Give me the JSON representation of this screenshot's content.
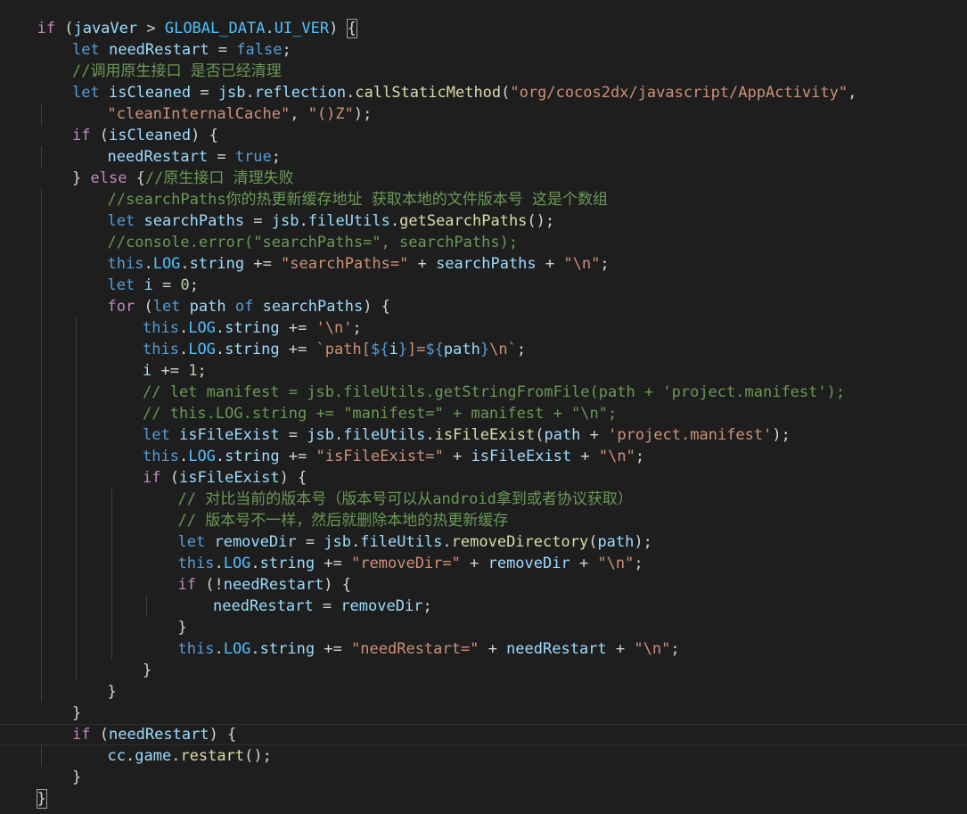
{
  "editor": {
    "title": "code-editor",
    "colors": {
      "background": "#1e1e1e",
      "keyword": "#569cd6",
      "control": "#c586c0",
      "variable": "#9cdcfe",
      "function": "#dcdcaa",
      "string": "#ce9178",
      "number": "#b5cea8",
      "comment": "#6a9955",
      "constant": "#4fc1ff"
    },
    "lines": [
      {
        "indent": 1,
        "tokens": [
          [
            "c",
            "if"
          ],
          [
            "p",
            " ("
          ],
          [
            "v",
            "javaVer"
          ],
          [
            "p",
            " > "
          ],
          [
            "cst",
            "GLOBAL_DATA"
          ],
          [
            "p",
            "."
          ],
          [
            "cst",
            "UI_VER"
          ],
          [
            "p",
            ") "
          ],
          [
            "bm",
            "{"
          ]
        ]
      },
      {
        "indent": 2,
        "tokens": [
          [
            "k",
            "let"
          ],
          [
            "p",
            " "
          ],
          [
            "v",
            "needRestart"
          ],
          [
            "p",
            " = "
          ],
          [
            "k",
            "false"
          ],
          [
            "p",
            ";"
          ]
        ]
      },
      {
        "indent": 2,
        "tokens": [
          [
            "cm",
            "//调用原生接口 是否已经清理"
          ]
        ]
      },
      {
        "indent": 2,
        "tokens": [
          [
            "k",
            "let"
          ],
          [
            "p",
            " "
          ],
          [
            "v",
            "isCleaned"
          ],
          [
            "p",
            " = "
          ],
          [
            "v",
            "jsb"
          ],
          [
            "p",
            "."
          ],
          [
            "v",
            "reflection"
          ],
          [
            "p",
            "."
          ],
          [
            "f",
            "callStaticMethod"
          ],
          [
            "p",
            "("
          ],
          [
            "s",
            "\"org/cocos2dx/javascript/AppActivity\""
          ],
          [
            "p",
            ","
          ]
        ]
      },
      {
        "indent": 3,
        "tokens": [
          [
            "s",
            "\"cleanInternalCache\""
          ],
          [
            "p",
            ", "
          ],
          [
            "s",
            "\"()Z\""
          ],
          [
            "p",
            ");"
          ]
        ]
      },
      {
        "indent": 2,
        "tokens": [
          [
            "c",
            "if"
          ],
          [
            "p",
            " ("
          ],
          [
            "v",
            "isCleaned"
          ],
          [
            "p",
            ") {"
          ]
        ]
      },
      {
        "indent": 3,
        "tokens": [
          [
            "v",
            "needRestart"
          ],
          [
            "p",
            " = "
          ],
          [
            "k",
            "true"
          ],
          [
            "p",
            ";"
          ]
        ]
      },
      {
        "indent": 2,
        "tokens": [
          [
            "p",
            "} "
          ],
          [
            "c",
            "else"
          ],
          [
            "p",
            " {"
          ],
          [
            "cm",
            "//原生接口 清理失败"
          ]
        ]
      },
      {
        "indent": 3,
        "tokens": [
          [
            "cm",
            "//searchPaths你的热更新缓存地址 获取本地的文件版本号 这是个数组"
          ]
        ]
      },
      {
        "indent": 3,
        "tokens": [
          [
            "k",
            "let"
          ],
          [
            "p",
            " "
          ],
          [
            "v",
            "searchPaths"
          ],
          [
            "p",
            " = "
          ],
          [
            "v",
            "jsb"
          ],
          [
            "p",
            "."
          ],
          [
            "v",
            "fileUtils"
          ],
          [
            "p",
            "."
          ],
          [
            "f",
            "getSearchPaths"
          ],
          [
            "p",
            "();"
          ]
        ]
      },
      {
        "indent": 3,
        "tokens": [
          [
            "cm",
            "//console.error(\"searchPaths=\", searchPaths);"
          ]
        ]
      },
      {
        "indent": 3,
        "tokens": [
          [
            "k",
            "this"
          ],
          [
            "p",
            "."
          ],
          [
            "cst",
            "LOG"
          ],
          [
            "p",
            "."
          ],
          [
            "v",
            "string"
          ],
          [
            "p",
            " += "
          ],
          [
            "s",
            "\"searchPaths=\""
          ],
          [
            "p",
            " + "
          ],
          [
            "v",
            "searchPaths"
          ],
          [
            "p",
            " + "
          ],
          [
            "s",
            "\"\\n\""
          ],
          [
            "p",
            ";"
          ]
        ]
      },
      {
        "indent": 3,
        "tokens": [
          [
            "k",
            "let"
          ],
          [
            "p",
            " "
          ],
          [
            "v",
            "i"
          ],
          [
            "p",
            " = "
          ],
          [
            "n",
            "0"
          ],
          [
            "p",
            ";"
          ]
        ]
      },
      {
        "indent": 3,
        "tokens": [
          [
            "c",
            "for"
          ],
          [
            "p",
            " ("
          ],
          [
            "k",
            "let"
          ],
          [
            "p",
            " "
          ],
          [
            "v",
            "path"
          ],
          [
            "p",
            " "
          ],
          [
            "k",
            "of"
          ],
          [
            "p",
            " "
          ],
          [
            "v",
            "searchPaths"
          ],
          [
            "p",
            ") {"
          ]
        ]
      },
      {
        "indent": 4,
        "tokens": [
          [
            "k",
            "this"
          ],
          [
            "p",
            "."
          ],
          [
            "cst",
            "LOG"
          ],
          [
            "p",
            "."
          ],
          [
            "v",
            "string"
          ],
          [
            "p",
            " += "
          ],
          [
            "s",
            "'\\n'"
          ],
          [
            "p",
            ";"
          ]
        ]
      },
      {
        "indent": 4,
        "tokens": [
          [
            "k",
            "this"
          ],
          [
            "p",
            "."
          ],
          [
            "cst",
            "LOG"
          ],
          [
            "p",
            "."
          ],
          [
            "v",
            "string"
          ],
          [
            "p",
            " += "
          ],
          [
            "s",
            "`path["
          ],
          [
            "k",
            "${"
          ],
          [
            "v",
            "i"
          ],
          [
            "k",
            "}"
          ],
          [
            "s",
            "]="
          ],
          [
            "k",
            "${"
          ],
          [
            "v",
            "path"
          ],
          [
            "k",
            "}"
          ],
          [
            "s",
            "\\n`"
          ],
          [
            "p",
            ";"
          ]
        ]
      },
      {
        "indent": 4,
        "tokens": [
          [
            "v",
            "i"
          ],
          [
            "p",
            " += "
          ],
          [
            "n",
            "1"
          ],
          [
            "p",
            ";"
          ]
        ]
      },
      {
        "indent": 4,
        "tokens": [
          [
            "cm",
            "// let manifest = jsb.fileUtils.getStringFromFile(path + 'project.manifest');"
          ]
        ]
      },
      {
        "indent": 4,
        "tokens": [
          [
            "cm",
            "// this.LOG.string += \"manifest=\" + manifest + \"\\n\";"
          ]
        ]
      },
      {
        "indent": 4,
        "tokens": [
          [
            "k",
            "let"
          ],
          [
            "p",
            " "
          ],
          [
            "v",
            "isFileExist"
          ],
          [
            "p",
            " = "
          ],
          [
            "v",
            "jsb"
          ],
          [
            "p",
            "."
          ],
          [
            "v",
            "fileUtils"
          ],
          [
            "p",
            "."
          ],
          [
            "f",
            "isFileExist"
          ],
          [
            "p",
            "("
          ],
          [
            "v",
            "path"
          ],
          [
            "p",
            " + "
          ],
          [
            "s",
            "'project.manifest'"
          ],
          [
            "p",
            ");"
          ]
        ]
      },
      {
        "indent": 4,
        "tokens": [
          [
            "k",
            "this"
          ],
          [
            "p",
            "."
          ],
          [
            "cst",
            "LOG"
          ],
          [
            "p",
            "."
          ],
          [
            "v",
            "string"
          ],
          [
            "p",
            " += "
          ],
          [
            "s",
            "\"isFileExist=\""
          ],
          [
            "p",
            " + "
          ],
          [
            "v",
            "isFileExist"
          ],
          [
            "p",
            " + "
          ],
          [
            "s",
            "\"\\n\""
          ],
          [
            "p",
            ";"
          ]
        ]
      },
      {
        "indent": 4,
        "tokens": [
          [
            "c",
            "if"
          ],
          [
            "p",
            " ("
          ],
          [
            "v",
            "isFileExist"
          ],
          [
            "p",
            ") {"
          ]
        ]
      },
      {
        "indent": 5,
        "tokens": [
          [
            "cm",
            "// 对比当前的版本号（版本号可以从android拿到或者协议获取）"
          ]
        ]
      },
      {
        "indent": 5,
        "tokens": [
          [
            "cm",
            "// 版本号不一样，然后就删除本地的热更新缓存"
          ]
        ]
      },
      {
        "indent": 5,
        "tokens": [
          [
            "k",
            "let"
          ],
          [
            "p",
            " "
          ],
          [
            "v",
            "removeDir"
          ],
          [
            "p",
            " = "
          ],
          [
            "v",
            "jsb"
          ],
          [
            "p",
            "."
          ],
          [
            "v",
            "fileUtils"
          ],
          [
            "p",
            "."
          ],
          [
            "f",
            "removeDirectory"
          ],
          [
            "p",
            "("
          ],
          [
            "v",
            "path"
          ],
          [
            "p",
            ");"
          ]
        ]
      },
      {
        "indent": 5,
        "tokens": [
          [
            "k",
            "this"
          ],
          [
            "p",
            "."
          ],
          [
            "cst",
            "LOG"
          ],
          [
            "p",
            "."
          ],
          [
            "v",
            "string"
          ],
          [
            "p",
            " += "
          ],
          [
            "s",
            "\"removeDir=\""
          ],
          [
            "p",
            " + "
          ],
          [
            "v",
            "removeDir"
          ],
          [
            "p",
            " + "
          ],
          [
            "s",
            "\"\\n\""
          ],
          [
            "p",
            ";"
          ]
        ]
      },
      {
        "indent": 5,
        "tokens": [
          [
            "c",
            "if"
          ],
          [
            "p",
            " (!"
          ],
          [
            "v",
            "needRestart"
          ],
          [
            "p",
            ") {"
          ]
        ]
      },
      {
        "indent": 6,
        "tokens": [
          [
            "v",
            "needRestart"
          ],
          [
            "p",
            " = "
          ],
          [
            "v",
            "removeDir"
          ],
          [
            "p",
            ";"
          ]
        ]
      },
      {
        "indent": 5,
        "tokens": [
          [
            "p",
            "}"
          ]
        ]
      },
      {
        "indent": 5,
        "tokens": [
          [
            "k",
            "this"
          ],
          [
            "p",
            "."
          ],
          [
            "cst",
            "LOG"
          ],
          [
            "p",
            "."
          ],
          [
            "v",
            "string"
          ],
          [
            "p",
            " += "
          ],
          [
            "s",
            "\"needRestart=\""
          ],
          [
            "p",
            " + "
          ],
          [
            "v",
            "needRestart"
          ],
          [
            "p",
            " + "
          ],
          [
            "s",
            "\"\\n\""
          ],
          [
            "p",
            ";"
          ]
        ]
      },
      {
        "indent": 4,
        "tokens": [
          [
            "p",
            "}"
          ]
        ]
      },
      {
        "indent": 3,
        "tokens": [
          [
            "p",
            "}"
          ]
        ]
      },
      {
        "indent": 2,
        "tokens": [
          [
            "p",
            "}"
          ]
        ]
      },
      {
        "indent": 2,
        "tokens": [
          [
            "c",
            "if"
          ],
          [
            "p",
            " ("
          ],
          [
            "v",
            "needRestart"
          ],
          [
            "p",
            ") {"
          ]
        ],
        "current": true
      },
      {
        "indent": 3,
        "tokens": [
          [
            "v",
            "cc"
          ],
          [
            "p",
            "."
          ],
          [
            "v",
            "game"
          ],
          [
            "p",
            "."
          ],
          [
            "f",
            "restart"
          ],
          [
            "p",
            "();"
          ]
        ]
      },
      {
        "indent": 2,
        "tokens": [
          [
            "p",
            "}"
          ]
        ]
      },
      {
        "indent": 1,
        "tokens": [
          [
            "bm",
            "}"
          ]
        ]
      }
    ]
  }
}
